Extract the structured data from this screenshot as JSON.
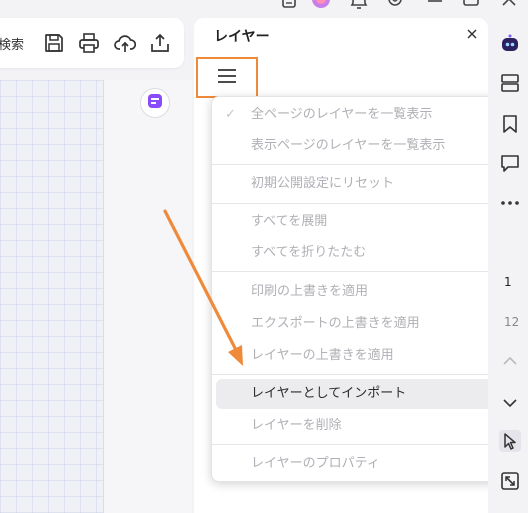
{
  "toolbar": {
    "search_label": "検索",
    "icons": [
      "save-icon",
      "print-icon",
      "cloud-upload-icon",
      "share-upload-icon"
    ]
  },
  "layers_panel": {
    "title": "レイヤー",
    "close_icon": "close-icon",
    "menu_icon": "hamburger-menu-icon"
  },
  "menu": {
    "items": [
      {
        "label": "全ページのレイヤーを一覧表示",
        "checked": true,
        "enabled": false
      },
      {
        "label": "表示ページのレイヤーを一覧表示",
        "checked": false,
        "enabled": false
      },
      {
        "label": "初期公開設定にリセット",
        "enabled": false
      },
      {
        "label": "すべてを展開",
        "enabled": false
      },
      {
        "label": "すべてを折りたたむ",
        "enabled": false
      },
      {
        "label": "印刷の上書きを適用",
        "enabled": false
      },
      {
        "label": "エクスポートの上書きを適用",
        "enabled": false
      },
      {
        "label": "レイヤーの上書きを適用",
        "enabled": false
      },
      {
        "label": "レイヤーとしてインポート",
        "enabled": true,
        "highlighted": true
      },
      {
        "label": "レイヤーを削除",
        "enabled": false
      },
      {
        "label": "レイヤーのプロパティ",
        "enabled": false
      }
    ]
  },
  "pagination": {
    "current_page": "1",
    "total_pages": "12"
  },
  "colors": {
    "accent_orange": "#f08a3b",
    "highlight_bg": "#ececef",
    "disabled_text": "#b0b0b6"
  }
}
